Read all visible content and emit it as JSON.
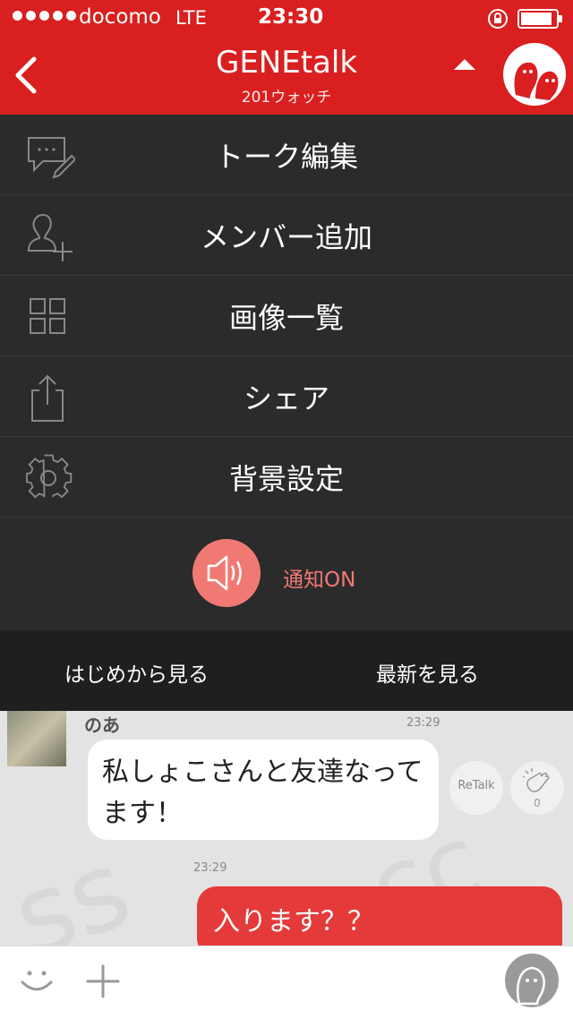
{
  "status_bar": {
    "carrier": "docomo",
    "network": "LTE",
    "time": "23:30"
  },
  "header": {
    "back_icon": "chevron-left-icon",
    "title": "GENEtalk",
    "subtitle": "201ウォッチ",
    "collapse_icon": "triangle-up-icon"
  },
  "menu": {
    "items": [
      {
        "label": "トーク編集",
        "icon": "edit-chat-icon"
      },
      {
        "label": "メンバー追加",
        "icon": "add-member-icon"
      },
      {
        "label": "画像一覧",
        "icon": "grid-icon"
      },
      {
        "label": "シェア",
        "icon": "share-icon"
      },
      {
        "label": "背景設定",
        "icon": "gear-icon"
      }
    ],
    "notify_label": "通知ON"
  },
  "nav": {
    "from_start": "はじめから見る",
    "latest": "最新を見る"
  },
  "chat": {
    "messages": [
      {
        "sender": "のあ",
        "time": "23:29",
        "text": "私しょこさんと友達なってます！",
        "retalk_label": "ReTalk",
        "clap_count": "0"
      },
      {
        "time": "23:29",
        "text": "入ります？？"
      }
    ]
  },
  "colors": {
    "brand_red": "#d91f1f",
    "menu_bg": "#2b2b2b",
    "notify_accent": "#f07a73"
  }
}
